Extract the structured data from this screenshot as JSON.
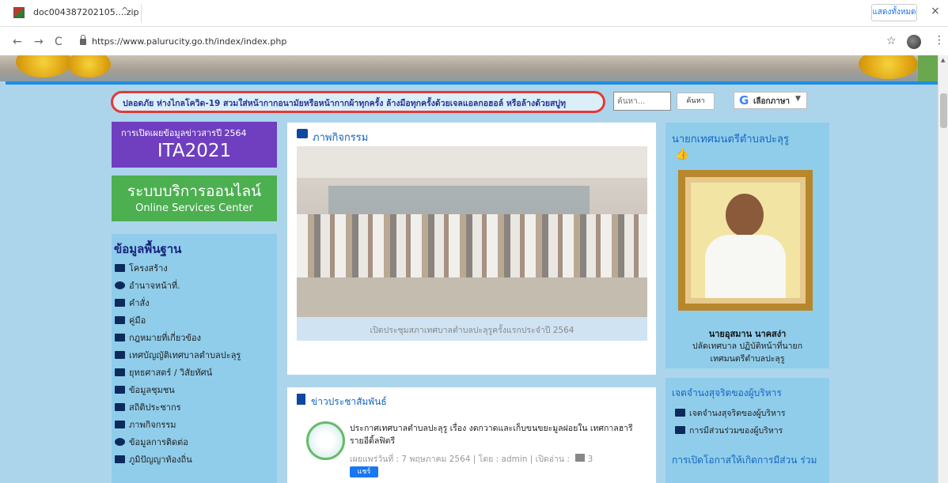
{
  "download": {
    "filename": "doc004387202105....zip",
    "chevron": "^",
    "show_all": "แสดงทั้งหมด",
    "close": "×"
  },
  "address": {
    "back": "←",
    "forward": "→",
    "reload": "C",
    "url": "https://www.palurucity.go.th/index/index.php",
    "star": "☆",
    "menu": "⋮"
  },
  "notice": {
    "text": "ปลอดภัย ห่างไกลโควิด-19 สวมใส่หน้ากากอนามัยหรือหน้ากากผ้าทุกครั้ง ล้างมือทุกครั้งด้วยเจลแอลกอฮอล์ หรือล้างด้วยสบู่ทุ"
  },
  "search": {
    "placeholder": "ค้นหา...",
    "button": "ค้นหา"
  },
  "translate": {
    "label": "เลือกภาษา",
    "arrow": "▼",
    "g": "G"
  },
  "ita": {
    "subtitle": "การเปิดเผยข้อมูลข่าวสารปี 2564",
    "title": "ITA2021"
  },
  "services": {
    "th": "ระบบบริการออนไลน์",
    "en": "Online Services Center"
  },
  "basic": {
    "title": "ข้อมูลพื้นฐาน",
    "items": [
      "โครงสร้าง",
      "อำนาจหน้าที่.",
      "คำสั่ง",
      "คู่มือ",
      "กฎหมายที่เกี่ยวข้อง",
      "เทศบัญญัติเทศบาลตำบลปะลุรู",
      "ยุทธศาสตร์ / วิสัยทัศน์",
      "ข้อมูลชุมชน",
      "สถิติประชากร",
      "ภาพกิจกรรม",
      "ข้อมูลการติดต่อ",
      "ภูมิปัญญาท้องถิ่น"
    ]
  },
  "activities": {
    "title": "ภาพกิจกรรม",
    "caption": "เปิดประชุมสภาเทศบาลตำบลปะลุรูครั้งแรกประจำปี 2564"
  },
  "news": {
    "title": "ข่าวประชาสัมพันธ์",
    "headline": "ประกาศเทศบาลตำบลปะลุรู เรื่อง งดกวาดและเก็บขนขยะมูลฝอยใน เทศกาลฮารีรายอีดิ้ลฟิตรี",
    "meta": "เผยแพร่วันที่ : 7 พฤษภาคม 2564 | โดย : admin | เปิดอ่าน :",
    "reads": "3",
    "share": "แชร์"
  },
  "mayor": {
    "title": "นายกเทศมนตรีตำบลปะลุรู",
    "name": "นายอุสมาน นาคสง่า",
    "pos1": "ปลัดเทศบาล ปฏิบัติหน้าที่นายก",
    "pos2": "เทศมนตรีตำบลปะลุรู"
  },
  "ethics": {
    "title": "เจตจำนงสุจริตของผู้บริหาร",
    "item1": "เจตจำนงสุจริตของผู้บริหาร",
    "item2": "การมีส่วนร่วมของผู้บริหาร"
  },
  "open": {
    "title": "การเปิดโอกาสให้เกิดการมีส่วน ร่วม"
  },
  "colors": {
    "accent": "#1565c0",
    "purple": "#6f3fbf",
    "green": "#4caf50",
    "panel": "#8fcdeb"
  }
}
